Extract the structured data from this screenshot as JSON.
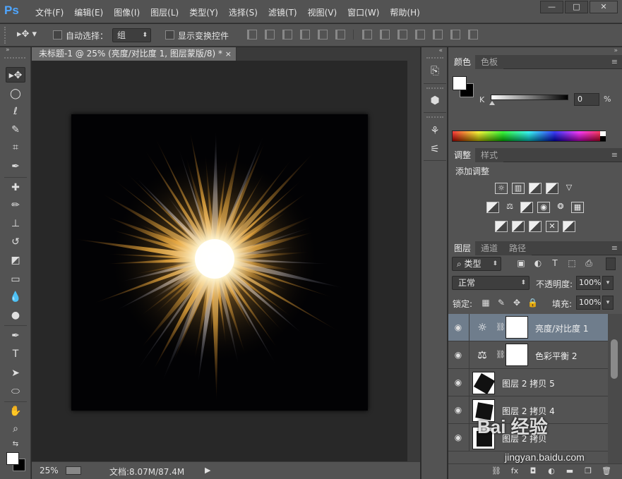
{
  "app": {
    "logo": "Ps"
  },
  "menu": [
    "文件(F)",
    "编辑(E)",
    "图像(I)",
    "图层(L)",
    "类型(Y)",
    "选择(S)",
    "滤镜(T)",
    "视图(V)",
    "窗口(W)",
    "帮助(H)"
  ],
  "window_buttons": {
    "minimize": "—",
    "maximize": "□",
    "close": "✕"
  },
  "options": {
    "auto_select_label": "自动选择：",
    "auto_select_value": "组",
    "show_transform_label": "显示变换控件",
    "auto_select_checked": false,
    "show_transform_checked": false
  },
  "document": {
    "tab_title": "未标题-1 @ 25% (亮度/对比度 1, 图层蒙版/8) *",
    "tab_close": "×",
    "zoom": "25%",
    "doc_size": "文档:8.07M/87.4M"
  },
  "color_panel": {
    "tabs": [
      "颜色",
      "色板"
    ],
    "k_label": "K",
    "k_value": "0",
    "k_unit": "%",
    "foreground": "#ffffff",
    "background": "#000000"
  },
  "adjustments_panel": {
    "tabs": [
      "调整",
      "样式"
    ],
    "title": "添加调整",
    "row1": [
      "brightness-icon",
      "levels-icon",
      "curves-icon",
      "exposure-icon",
      "triangle-icon"
    ],
    "row2": [
      "vibrance-icon",
      "color-balance-icon",
      "bw-icon",
      "photo-filter-icon",
      "channel-mixer-icon",
      "color-lookup-icon"
    ],
    "row3": [
      "invert-icon",
      "posterize-icon",
      "threshold-icon",
      "selective-color-icon",
      "gradient-map-icon"
    ]
  },
  "layers_panel": {
    "tabs": [
      "图层",
      "通道",
      "路径"
    ],
    "kind_filter": "类型",
    "blend_mode": "正常",
    "opacity_label": "不透明度:",
    "opacity_value": "100%",
    "lock_label": "锁定:",
    "fill_label": "填充:",
    "fill_value": "100%",
    "layers": [
      {
        "name": "亮度/对比度 1",
        "type": "adjustment",
        "selected": true
      },
      {
        "name": "色彩平衡 2",
        "type": "adjustment",
        "selected": false
      },
      {
        "name": "图层 2 拷贝 5",
        "type": "image",
        "selected": false
      },
      {
        "name": "图层 2 拷贝 4",
        "type": "image",
        "selected": false
      },
      {
        "name": "图层 2 拷贝",
        "type": "image",
        "selected": false
      }
    ]
  },
  "watermark": {
    "main": "Bai 经验",
    "sub": "jingyan.baidu.com"
  }
}
